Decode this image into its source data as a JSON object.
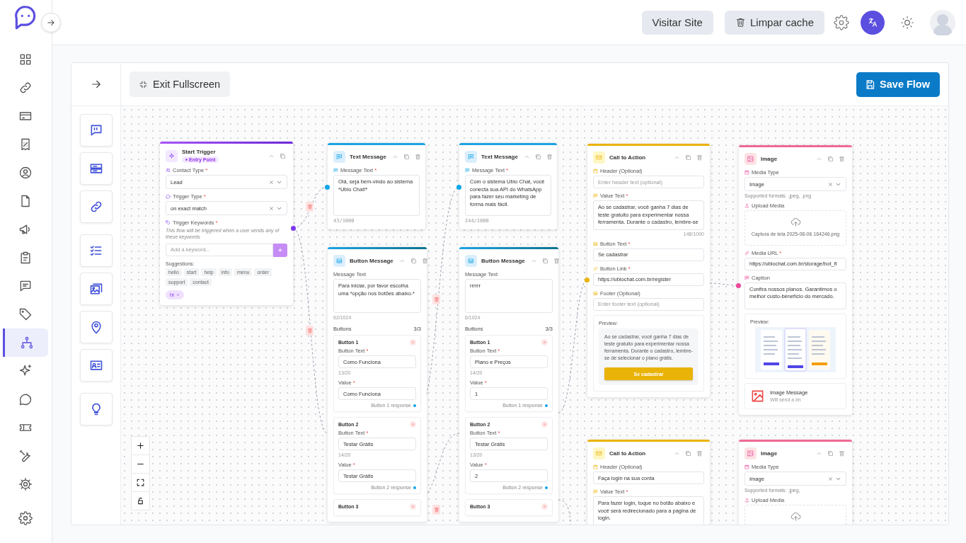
{
  "sidebar": {
    "items": [
      {
        "selected": false
      },
      {
        "selected": false
      },
      {
        "selected": false
      },
      {
        "selected": false
      },
      {
        "selected": false
      },
      {
        "selected": false
      },
      {
        "selected": false
      },
      {
        "selected": false
      },
      {
        "selected": false
      },
      {
        "selected": false
      },
      {
        "selected": true
      },
      {
        "selected": false
      },
      {
        "selected": false
      },
      {
        "selected": false
      },
      {
        "selected": false
      },
      {
        "selected": false
      },
      {
        "selected": false
      }
    ]
  },
  "header": {
    "visit_site": "Visitar Site",
    "clear_cache": "Limpar cache"
  },
  "editor": {
    "exit_fullscreen": "Exit Fullscreen",
    "save_flow": "Save Flow"
  },
  "nodes": [
    {
      "kind": "trigger",
      "title": "Start Trigger",
      "badge": "Entry Point",
      "fields": [
        {
          "kind": "select",
          "label": "Contact Type",
          "mark": "*",
          "value": "Lead"
        },
        {
          "kind": "select",
          "label": "Trigger Type",
          "mark": "*",
          "value": "on exact match"
        },
        {
          "kind": "keywords",
          "label": "Trigger Keywords",
          "mark": "*",
          "hint": "This flow will be triggered when a user sends any of these keywords",
          "placeholder": "Add a keyword...",
          "add": "+",
          "suggestions_label": "Suggestions:",
          "suggestions": [
            "hello",
            "start",
            "help",
            "info",
            "menu",
            "order",
            "support",
            "contact"
          ],
          "chosen": [
            "hi"
          ]
        }
      ]
    },
    {
      "kind": "text",
      "title": "Text Message",
      "fields": [
        {
          "kind": "textarea",
          "label": "Message Text",
          "mark": "*",
          "value": "Olá, seja bem-vindo ao sistema *Ublo Chat!*",
          "counter": "43/1000"
        }
      ]
    },
    {
      "kind": "buttons",
      "title": "Button Message",
      "fields": [
        {
          "kind": "textarea",
          "label": "Message Text",
          "value": "Para iniciar, por favor escolha uma *opção nos botões abaixo.*",
          "counter": "62/1024"
        },
        {
          "kind": "buttons",
          "label": "Buttons",
          "count": "3/3",
          "items": [
            {
              "title": "Button 1",
              "text_label": "Button Text",
              "text_mark": "*",
              "text": "Como Funciona",
              "counter": "13/20",
              "value_label": "Value",
              "value_mark": "*",
              "value": "Como Funciona",
              "response": "Button 1 response"
            },
            {
              "title": "Button 2",
              "text_label": "Button Text",
              "text_mark": "*",
              "text": "Testar Grátis",
              "counter": "14/20",
              "value_label": "Value",
              "value_mark": "*",
              "value": "Testar Grátis",
              "response": "Button 2 response"
            },
            {
              "title": "Button 3"
            }
          ]
        }
      ]
    },
    {
      "kind": "text",
      "title": "Text Message",
      "fields": [
        {
          "kind": "textarea",
          "label": "Message Text",
          "mark": "*",
          "value": "Com o sistema Ublo Chat, você conecta sua API do WhatsApp para fazer seu marketing de forma mais fácil.",
          "counter": "244/1000"
        }
      ]
    },
    {
      "kind": "buttons",
      "title": "Button Message",
      "fields": [
        {
          "kind": "textarea",
          "label": "Message Text",
          "value": "rrrrrr",
          "counter": "6/1024"
        },
        {
          "kind": "buttons",
          "label": "Buttons",
          "count": "3/3",
          "items": [
            {
              "title": "Button 1",
              "text_label": "Button Text",
              "text_mark": "*",
              "text": "Plano e Preços",
              "counter": "14/20",
              "value_label": "Value",
              "value_mark": "*",
              "value": "1",
              "response": "Button 1 response"
            },
            {
              "title": "Button 2",
              "text_label": "Button Text",
              "text_mark": "*",
              "text": "Testar Grátis",
              "counter": "13/20",
              "value_label": "Value",
              "value_mark": "*",
              "value": "2",
              "response": "Button 2 response"
            },
            {
              "title": "Button 3"
            }
          ]
        }
      ]
    },
    {
      "kind": "cta",
      "title": "Call to Action",
      "fields": [
        {
          "kind": "input",
          "label": "Header (Optional)",
          "placeholder": "Enter header text (optional)"
        },
        {
          "kind": "textarea",
          "label": "Value Text",
          "mark": "*",
          "value": "Ao se cadastrar, você ganha 7 dias de teste gratuito para experimentar nossa ferramenta. Durante o cadastro, lembre-se",
          "counter": "148/1000"
        },
        {
          "kind": "input",
          "label": "Button Text",
          "mark": "*",
          "value": "Se cadastrar"
        },
        {
          "kind": "input",
          "label": "Button Link",
          "mark": "*",
          "value": "https://ublochat.com.br/register"
        },
        {
          "kind": "input",
          "label": "Footer (Optional)",
          "placeholder": "Enter footer text (optional)"
        },
        {
          "kind": "cta_preview",
          "label": "Preview:",
          "text": "Ao se cadastrar, você ganha 7 dias de teste gratuito para experimentar nossa ferramenta. Durante o cadastro, lembre-se de selecionar o plano grátis.",
          "button": "Se cadastrar"
        }
      ]
    },
    {
      "kind": "cta",
      "title": "Call to Action",
      "fields": [
        {
          "kind": "input",
          "label": "Header (Optional)",
          "value": "Faça login na sua conta"
        },
        {
          "kind": "textarea",
          "label": "Value Text",
          "mark": "*",
          "value": "Para fazer login, toque no botão abaixo e você será redirecionado para a página de login."
        }
      ]
    },
    {
      "kind": "image",
      "title": "Image",
      "fields": [
        {
          "kind": "select",
          "label": "Media Type",
          "value": "Image",
          "hint": "Supported formats: .jpeg, .png"
        },
        {
          "kind": "upload",
          "label": "Upload Media",
          "file": "Captura de tela 2025-08-06 164246.png"
        },
        {
          "kind": "input",
          "label": "Media URL",
          "mark": "*",
          "value": "https://ublochat.com.br/storage/bot_fi"
        },
        {
          "kind": "textarea",
          "label": "Caption",
          "value": "Confira nossos planos. Garantimos o melhor custo-benefício do mercado."
        },
        {
          "kind": "image_preview",
          "label": "Preview:"
        },
        {
          "kind": "summary",
          "title": "Image Message",
          "text": "Will send a im"
        }
      ]
    },
    {
      "kind": "image",
      "title": "Image",
      "fields": [
        {
          "kind": "select",
          "label": "Media Type",
          "value": "Image",
          "hint": "Supported formats: .jpeg,"
        },
        {
          "kind": "upload",
          "label": "Upload Media"
        }
      ]
    }
  ]
}
